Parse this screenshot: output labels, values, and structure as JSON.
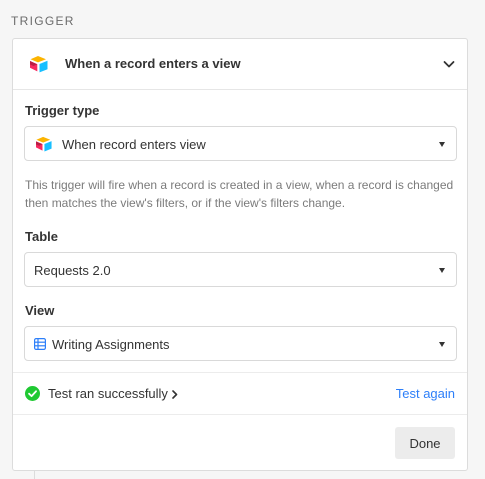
{
  "section": {
    "label": "TRIGGER"
  },
  "header": {
    "title": "When a record enters a view",
    "logo_icon": "airtable-logo-icon",
    "toggle_icon": "chevron-down-icon"
  },
  "trigger_type": {
    "label": "Trigger type",
    "value": "When record enters view",
    "icon": "airtable-logo-icon"
  },
  "help_text": "This trigger will fire when a record is created in a view, when a record is changed then matches the view's filters, or if the view's filters change.",
  "table": {
    "label": "Table",
    "value": "Requests 2.0"
  },
  "view": {
    "label": "View",
    "value": "Writing Assignments",
    "icon": "grid-view-icon"
  },
  "status": {
    "text": "Test ran successfully",
    "icon": "check-circle-icon",
    "action": "Test again"
  },
  "footer": {
    "done_label": "Done"
  },
  "colors": {
    "accent": "#2d7ff9",
    "success": "#20c933",
    "grid_icon": "#2d7ff9"
  }
}
